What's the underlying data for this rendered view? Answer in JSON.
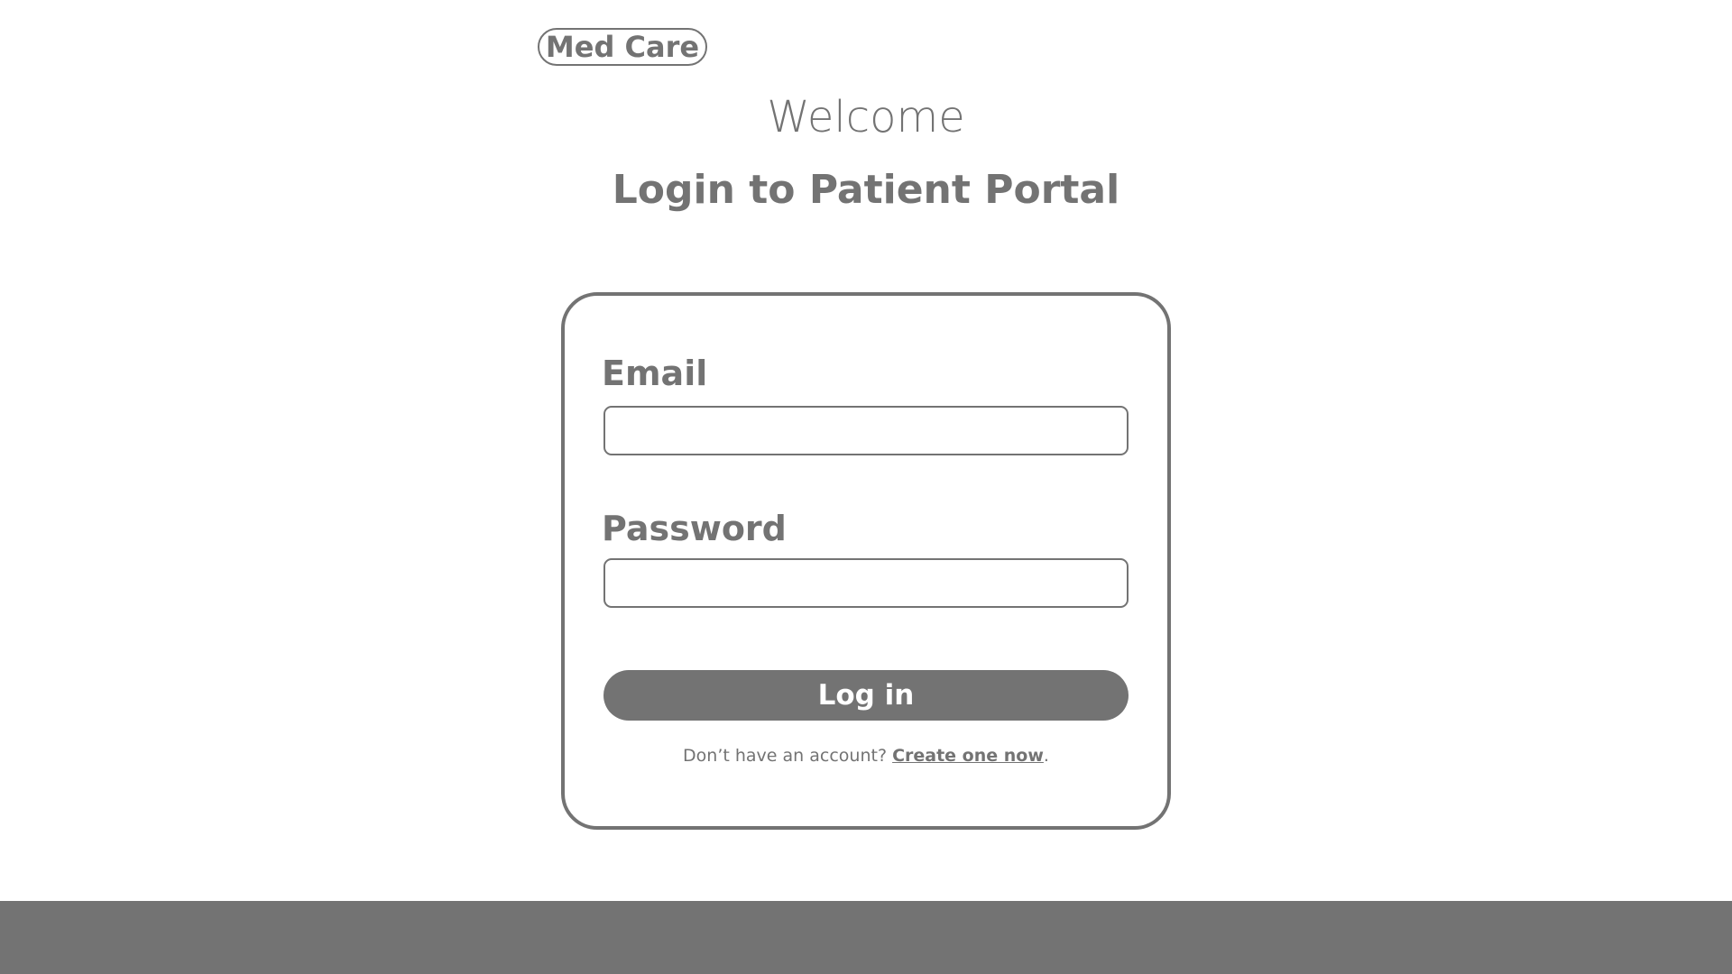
{
  "header": {
    "logo_text": "Med Care",
    "welcome": "Welcome",
    "subtitle": "Login to Patient Portal"
  },
  "login_form": {
    "email_label": "Email",
    "email_value": "",
    "email_placeholder": "",
    "password_label": "Password",
    "password_value": "",
    "password_placeholder": "",
    "submit_label": "Log in",
    "signup_prompt": "Don’t have an account? ",
    "signup_link": "Create one now",
    "signup_suffix": "."
  },
  "colors": {
    "primary_gray": "#737373",
    "background": "#ffffff",
    "button_text": "#ffffff"
  }
}
